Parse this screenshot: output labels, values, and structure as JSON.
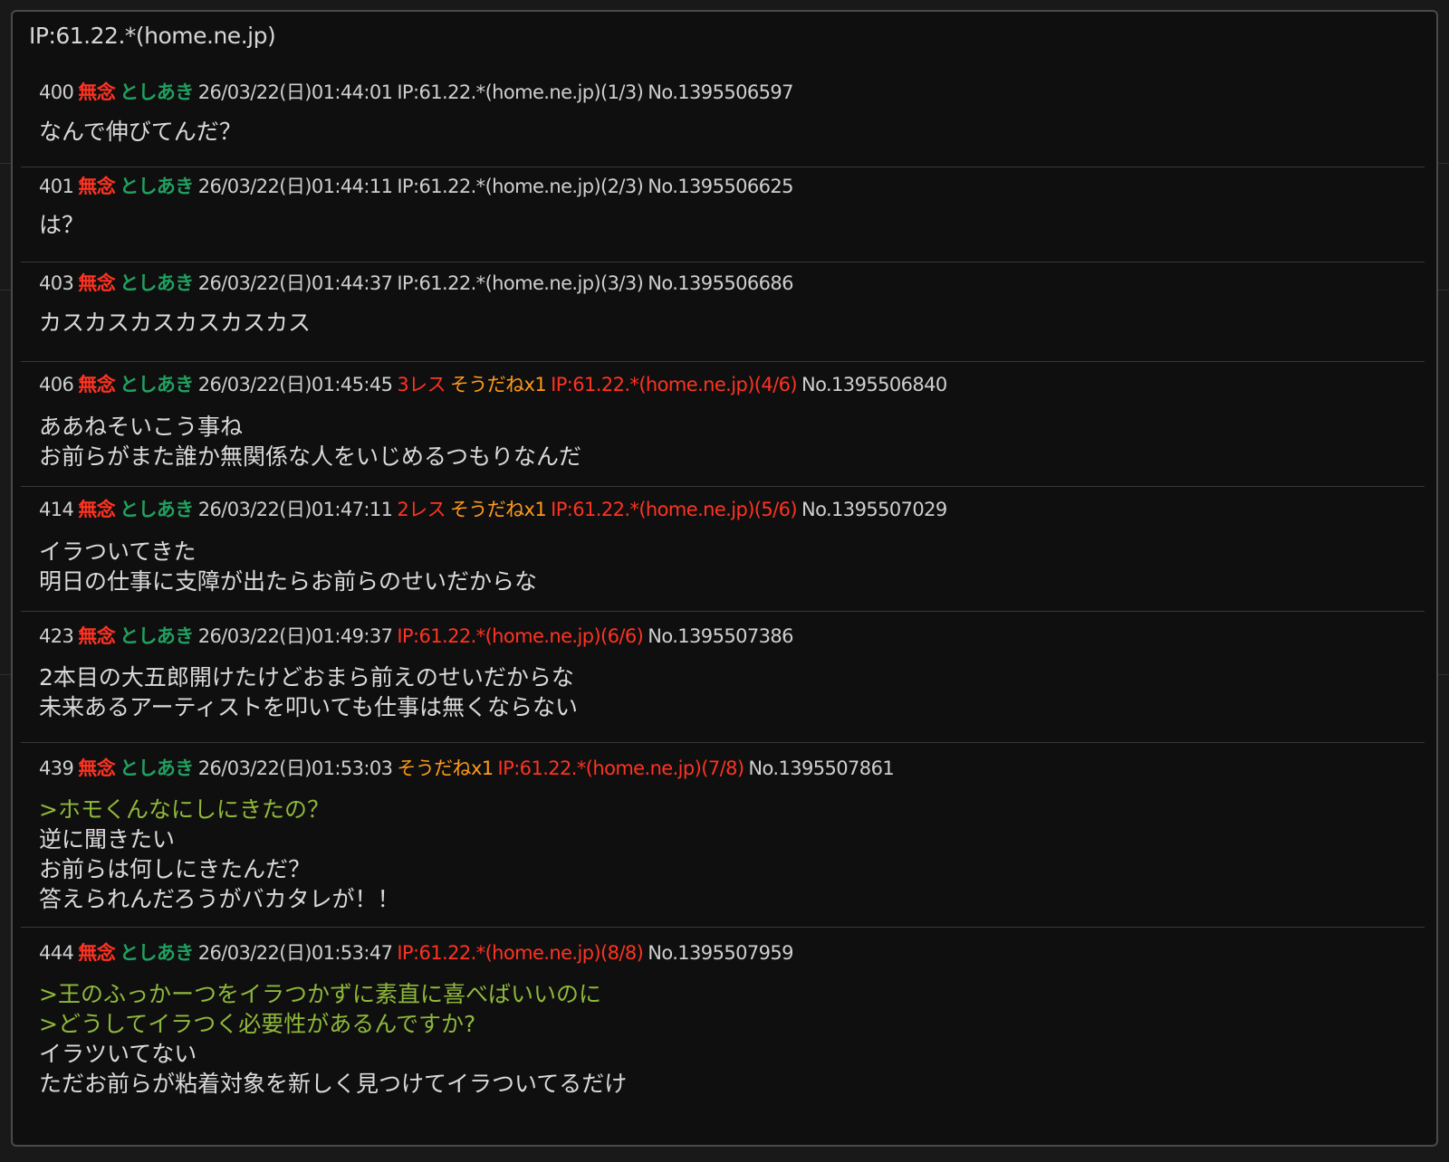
{
  "popup": {
    "title": "IP:61.22.*(home.ne.jp)"
  },
  "posts": [
    {
      "num": "400",
      "subject": "無念",
      "name": "としあき",
      "date": "26/03/22(日)01:44:01",
      "res_count": "",
      "soudane": "",
      "ip": "IP:61.22.*(home.ne.jp)(1/3)",
      "ip_highlight": false,
      "post_no": "No.1395506597",
      "lines": [
        {
          "text": "なんで伸びてんだ？",
          "quote": false
        }
      ]
    },
    {
      "num": "401",
      "subject": "無念",
      "name": "としあき",
      "date": "26/03/22(日)01:44:11",
      "res_count": "",
      "soudane": "",
      "ip": "IP:61.22.*(home.ne.jp)(2/3)",
      "ip_highlight": false,
      "post_no": "No.1395506625",
      "lines": [
        {
          "text": "は？",
          "quote": false
        }
      ]
    },
    {
      "num": "403",
      "subject": "無念",
      "name": "としあき",
      "date": "26/03/22(日)01:44:37",
      "res_count": "",
      "soudane": "",
      "ip": "IP:61.22.*(home.ne.jp)(3/3)",
      "ip_highlight": false,
      "post_no": "No.1395506686",
      "lines": [
        {
          "text": "カスカスカスカスカスカス",
          "quote": false
        }
      ]
    },
    {
      "num": "406",
      "subject": "無念",
      "name": "としあき",
      "date": "26/03/22(日)01:45:45",
      "res_count": "3レス",
      "soudane": "そうだねx1",
      "ip": "IP:61.22.*(home.ne.jp)(4/6)",
      "ip_highlight": true,
      "post_no": "No.1395506840",
      "lines": [
        {
          "text": "ああねそいこう事ね",
          "quote": false
        },
        {
          "text": "お前らがまた誰か無関係な人をいじめるつもりなんだ",
          "quote": false
        }
      ]
    },
    {
      "num": "414",
      "subject": "無念",
      "name": "としあき",
      "date": "26/03/22(日)01:47:11",
      "res_count": "2レス",
      "soudane": "そうだねx1",
      "ip": "IP:61.22.*(home.ne.jp)(5/6)",
      "ip_highlight": true,
      "post_no": "No.1395507029",
      "lines": [
        {
          "text": "イラついてきた",
          "quote": false
        },
        {
          "text": "明日の仕事に支障が出たらお前らのせいだからな",
          "quote": false
        }
      ]
    },
    {
      "num": "423",
      "subject": "無念",
      "name": "としあき",
      "date": "26/03/22(日)01:49:37",
      "res_count": "",
      "soudane": "",
      "ip": "IP:61.22.*(home.ne.jp)(6/6)",
      "ip_highlight": true,
      "post_no": "No.1395507386",
      "lines": [
        {
          "text": "2本目の大五郎開けたけどおまら前えのせいだからな",
          "quote": false
        },
        {
          "text": "未来あるアーティストを叩いても仕事は無くならない",
          "quote": false
        }
      ]
    },
    {
      "num": "439",
      "subject": "無念",
      "name": "としあき",
      "date": "26/03/22(日)01:53:03",
      "res_count": "",
      "soudane": "そうだねx1",
      "ip": "IP:61.22.*(home.ne.jp)(7/8)",
      "ip_highlight": true,
      "post_no": "No.1395507861",
      "lines": [
        {
          "text": ">ホモくんなにしにきたの？",
          "quote": true
        },
        {
          "text": "逆に聞きたい",
          "quote": false
        },
        {
          "text": "お前らは何しにきたんだ？",
          "quote": false
        },
        {
          "text": "答えられんだろうがバカタレが！！",
          "quote": false
        }
      ]
    },
    {
      "num": "444",
      "subject": "無念",
      "name": "としあき",
      "date": "26/03/22(日)01:53:47",
      "res_count": "",
      "soudane": "",
      "ip": "IP:61.22.*(home.ne.jp)(8/8)",
      "ip_highlight": true,
      "post_no": "No.1395507959",
      "lines": [
        {
          "text": ">王のふっかーつをイラつかずに素直に喜べばいいのに",
          "quote": true
        },
        {
          "text": ">どうしてイラつく必要性があるんですか?",
          "quote": true
        },
        {
          "text": "イラツいてない",
          "quote": false
        },
        {
          "text": "ただお前らが粘着対象を新しく見つけてイラついてるだけ",
          "quote": false
        }
      ]
    }
  ],
  "colors": {
    "background": "#0f0f0f",
    "text": "#dadada",
    "subject": "#ff3322",
    "name": "#20a060",
    "res_count": "#ff3322",
    "soudane": "#ff9a1a",
    "ip_highlight": "#ff3322",
    "quote": "#8fb83a",
    "border": "#4a4a4a",
    "divider": "#383838"
  }
}
